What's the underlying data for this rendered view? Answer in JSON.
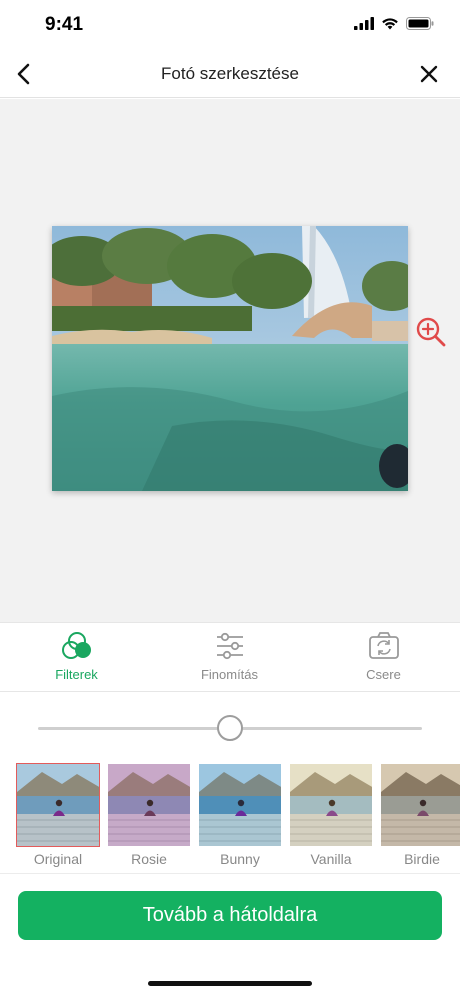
{
  "status_bar": {
    "time": "9:41"
  },
  "nav": {
    "title": "Fotó szerkesztése",
    "back_icon": "chevron-left-icon",
    "close_icon": "close-icon"
  },
  "editor": {
    "zoom_icon": "zoom-in-icon",
    "zoom_color": "#e04a4a"
  },
  "tabs": [
    {
      "label": "Filterek",
      "icon": "filters-icon",
      "active": true
    },
    {
      "label": "Finomítás",
      "icon": "sliders-icon",
      "active": false
    },
    {
      "label": "Csere",
      "icon": "replace-photo-icon",
      "active": false
    }
  ],
  "slider": {
    "value": 0.5
  },
  "filters": [
    {
      "label": "Original",
      "selected": true
    },
    {
      "label": "Rosie",
      "selected": false
    },
    {
      "label": "Bunny",
      "selected": false
    },
    {
      "label": "Vanilla",
      "selected": false
    },
    {
      "label": "Birdie",
      "selected": false
    }
  ],
  "cta": {
    "label": "Tovább a hátoldalra"
  },
  "colors": {
    "accent": "#14b161",
    "active_tab": "#1aa760",
    "selected_border": "#e35b5b"
  }
}
